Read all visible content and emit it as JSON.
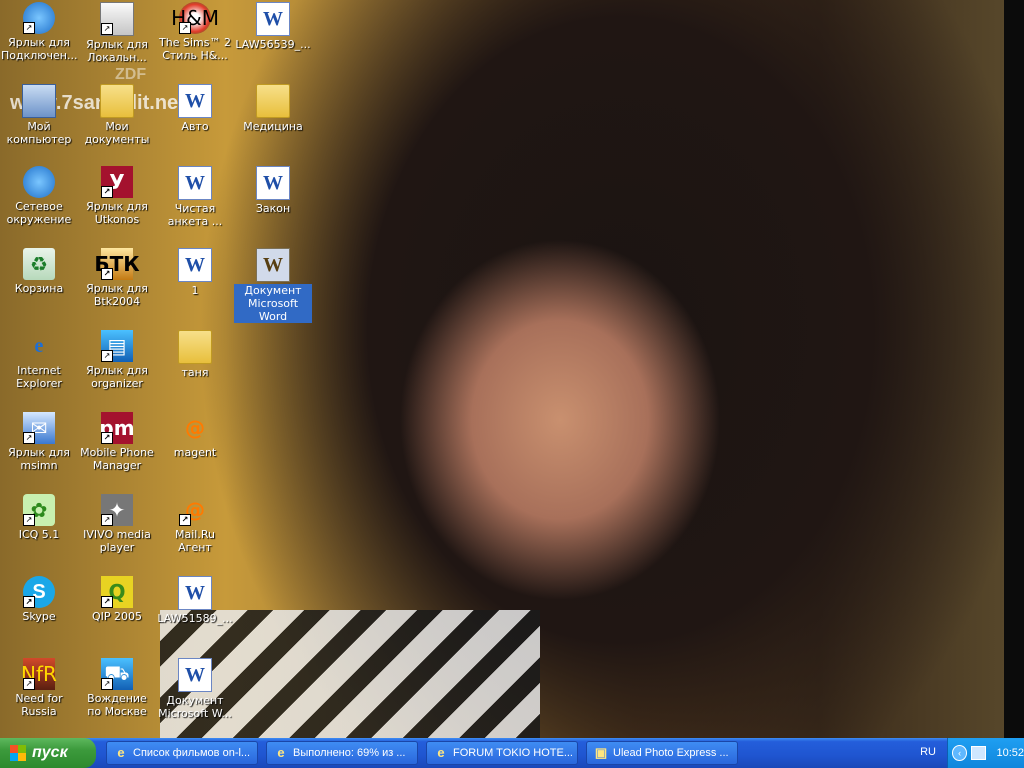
{
  "desktop": {
    "icons": [
      {
        "label": "Ярлык для Подключен...",
        "icon": "network-connection-icon",
        "shortcut": true
      },
      {
        "label": "Ярлык для Локальн...",
        "icon": "local-disk-icon",
        "shortcut": true
      },
      {
        "label": "The Sims™ 2 Стиль H&...",
        "icon": "sims-icon",
        "shortcut": true
      },
      {
        "label": "LAW56539_...",
        "icon": "word-document-icon",
        "shortcut": false
      },
      {
        "label": "Мой компьютер",
        "icon": "my-computer-icon",
        "shortcut": false
      },
      {
        "label": "Мои документы",
        "icon": "my-documents-icon",
        "shortcut": false
      },
      {
        "label": "Авто",
        "icon": "word-document-icon",
        "shortcut": false
      },
      {
        "label": "Медицина",
        "icon": "folder-icon",
        "shortcut": false
      },
      {
        "label": "Сетевое окружение",
        "icon": "network-places-icon",
        "shortcut": false
      },
      {
        "label": "Ярлык для Utkonos",
        "icon": "utkonos-icon",
        "shortcut": true
      },
      {
        "label": "Чистая анкета ...",
        "icon": "word-document-icon",
        "shortcut": false
      },
      {
        "label": "Закон",
        "icon": "word-document-icon",
        "shortcut": false
      },
      {
        "label": "Корзина",
        "icon": "recycle-bin-icon",
        "shortcut": false
      },
      {
        "label": "Ярлык для Btk2004",
        "icon": "btk-icon",
        "shortcut": true
      },
      {
        "label": "1",
        "icon": "word-document-icon",
        "shortcut": false
      },
      {
        "label": "Документ Microsoft Word",
        "icon": "word-document-icon",
        "shortcut": false,
        "selected": true
      },
      {
        "label": "Internet Explorer",
        "icon": "internet-explorer-icon",
        "shortcut": false
      },
      {
        "label": "Ярлык для organizer",
        "icon": "organizer-icon",
        "shortcut": true
      },
      {
        "label": "таня",
        "icon": "folder-icon",
        "shortcut": false
      },
      {
        "label": "Ярлык для msimn",
        "icon": "outlook-express-icon",
        "shortcut": true
      },
      {
        "label": "Mobile Phone Manager",
        "icon": "phone-manager-icon",
        "shortcut": true
      },
      {
        "label": "magent",
        "icon": "mail-agent-icon",
        "shortcut": false
      },
      {
        "label": "ICQ 5.1",
        "icon": "icq-icon",
        "shortcut": true
      },
      {
        "label": "IVIVO media player",
        "icon": "media-player-icon",
        "shortcut": true
      },
      {
        "label": "Mail.Ru Агент",
        "icon": "mail-agent-icon",
        "shortcut": true
      },
      {
        "label": "Skype",
        "icon": "skype-icon",
        "shortcut": true
      },
      {
        "label": "QIP 2005",
        "icon": "qip-icon",
        "shortcut": true
      },
      {
        "label": "LAW51589_...",
        "icon": "word-document-icon",
        "shortcut": false
      },
      {
        "label": "Need for Russia",
        "icon": "game-icon",
        "shortcut": true
      },
      {
        "label": "Вождение по Москве",
        "icon": "driving-game-icon",
        "shortcut": true
      },
      {
        "label": "Документ Microsoft W...",
        "icon": "word-document-icon",
        "shortcut": false
      }
    ],
    "wallpaper_text": "www.7sangulit.net",
    "wallpaper_logo": "ZDF"
  },
  "taskbar": {
    "start_label": "пуск",
    "tasks": [
      {
        "label": "Список фильмов on-l...",
        "icon": "internet-explorer-icon"
      },
      {
        "label": "Выполнено: 69% из ...",
        "icon": "internet-explorer-icon"
      },
      {
        "label": "FORUM TOKIO HOTE...",
        "icon": "internet-explorer-icon"
      },
      {
        "label": "Ulead Photo Express ...",
        "icon": "photo-express-icon"
      }
    ],
    "language": "RU",
    "clock": "10:52"
  }
}
